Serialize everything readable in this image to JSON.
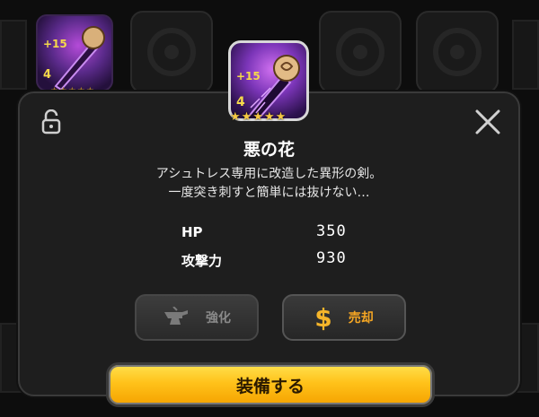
{
  "item": {
    "plus": "+15",
    "level": "4",
    "stars": [
      "★",
      "★",
      "★",
      "★",
      "★"
    ],
    "icon": "purple-sword-icon"
  },
  "modal": {
    "title": "悪の花",
    "description_line1": "アシュトレス専用に改造した異形の剣。",
    "description_line2": "一度突き刺すと簡単には抜けない…",
    "stats": [
      {
        "label": "HP",
        "value": "350"
      },
      {
        "label": "攻撃力",
        "value": "930"
      }
    ],
    "lock_icon": "unlock-icon",
    "close_icon": "close-icon"
  },
  "buttons": {
    "enhance_label": "強化",
    "enhance_icon": "anvil-icon",
    "sell_label": "売却",
    "sell_icon": "$",
    "equip_label": "装備する"
  },
  "background_item": {
    "plus": "+15",
    "level": "4"
  },
  "colors": {
    "equip": "#ffc21a",
    "sell_accent": "#f5a623",
    "star": "#f5c842"
  }
}
